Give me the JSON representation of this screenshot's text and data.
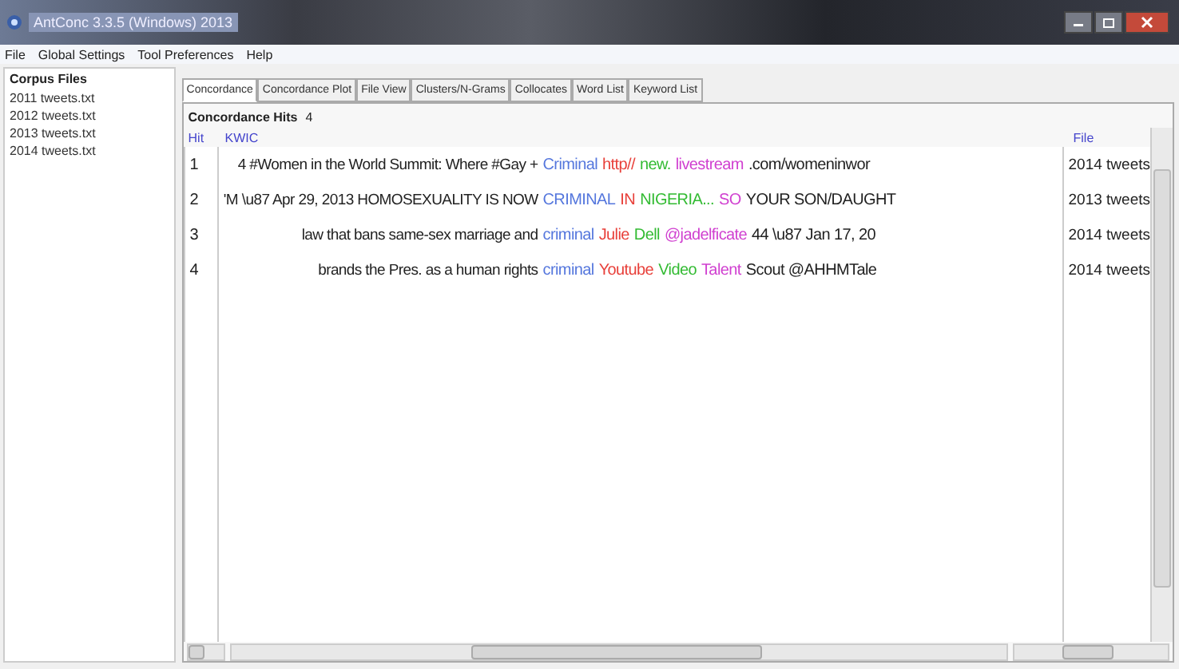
{
  "window": {
    "title": "AntConc 3.3.5 (Windows) 2013"
  },
  "menu": [
    "File",
    "Global Settings",
    "Tool Preferences",
    "Help"
  ],
  "corpus_files": {
    "title": "Corpus Files",
    "items": [
      "2011 tweets.txt",
      "2012 tweets.txt",
      "2013 tweets.txt",
      "2014 tweets.txt"
    ]
  },
  "tabs": [
    {
      "label": "Concordance",
      "selected": true
    },
    {
      "label": "Concordance Plot",
      "selected": false
    },
    {
      "label": "File View",
      "selected": false
    },
    {
      "label": "Clusters/N-Grams",
      "selected": false
    },
    {
      "label": "Collocates",
      "selected": false
    },
    {
      "label": "Word List",
      "selected": false
    },
    {
      "label": "Keyword List",
      "selected": false
    }
  ],
  "hits": {
    "label": "Concordance Hits",
    "count": "4"
  },
  "table": {
    "columns": [
      "Hit",
      "KWIC",
      "File"
    ],
    "rows": [
      {
        "hit": "1",
        "left": "4 #Women in the World Summit: Where #Gay +",
        "segments": [
          {
            "text": "Criminal",
            "color": "#5577dd"
          },
          {
            "text": "http//",
            "color": "#e8403a"
          },
          {
            "text": "new.",
            "color": "#33bb33"
          },
          {
            "text": "livestream",
            "color": "#d040d0"
          },
          {
            "text": ".com/womeninwor",
            "color": "#222222"
          }
        ],
        "file": "2014 tweets"
      },
      {
        "hit": "2",
        "left": "'M \\u87 Apr 29, 2013 HOMOSEXUALITY IS NOW",
        "segments": [
          {
            "text": "CRIMINAL",
            "color": "#5577dd"
          },
          {
            "text": "IN",
            "color": "#e8403a"
          },
          {
            "text": "NIGERIA...",
            "color": "#33bb33"
          },
          {
            "text": "SO",
            "color": "#d040d0"
          },
          {
            "text": "YOUR SON/DAUGHT",
            "color": "#222222"
          }
        ],
        "file": "2013 tweets"
      },
      {
        "hit": "3",
        "left": "law that bans same-sex marriage and",
        "segments": [
          {
            "text": "criminal",
            "color": "#5577dd"
          },
          {
            "text": "Julie",
            "color": "#e8403a"
          },
          {
            "text": "Dell",
            "color": "#33bb33"
          },
          {
            "text": "@jadelficate",
            "color": "#d040d0"
          },
          {
            "text": "44 \\u87 Jan 17, 20",
            "color": "#222222"
          }
        ],
        "file": "2014 tweets"
      },
      {
        "hit": "4",
        "left": "brands the Pres. as a human rights",
        "segments": [
          {
            "text": "criminal",
            "color": "#5577dd"
          },
          {
            "text": "Youtube",
            "color": "#e8403a"
          },
          {
            "text": "Video",
            "color": "#33bb33"
          },
          {
            "text": "Talent",
            "color": "#d040d0"
          },
          {
            "text": "Scout @AHHMTale",
            "color": "#222222"
          }
        ],
        "file": "2014 tweets"
      }
    ]
  }
}
